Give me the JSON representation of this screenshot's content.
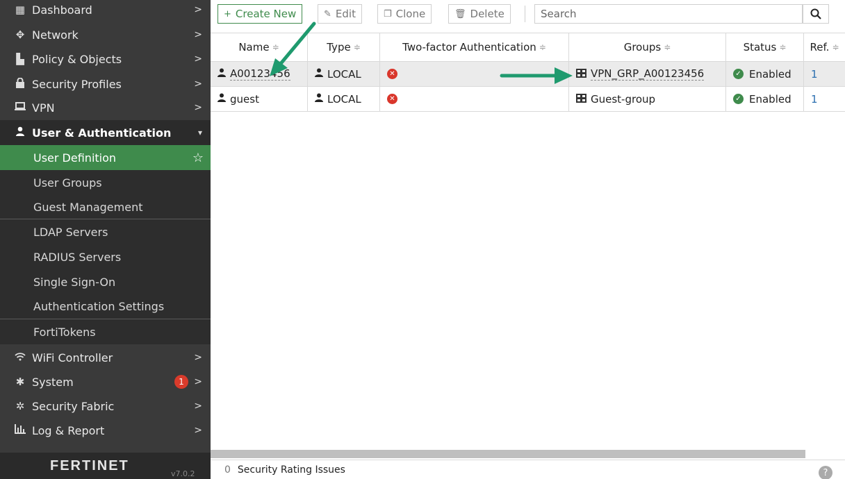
{
  "sidebar": {
    "items": [
      {
        "label": "Dashboard",
        "icon": "dashboard-icon",
        "glyph": "▦"
      },
      {
        "label": "Network",
        "icon": "network-icon",
        "glyph": "✥"
      },
      {
        "label": "Policy & Objects",
        "icon": "policy-icon",
        "glyph": "▙"
      },
      {
        "label": "Security Profiles",
        "icon": "lock-icon",
        "glyph": "🔒"
      },
      {
        "label": "VPN",
        "icon": "laptop-icon",
        "glyph": "▭"
      },
      {
        "label": "User & Authentication",
        "icon": "user-icon",
        "glyph": "👤"
      }
    ],
    "sub_items": [
      {
        "label": "User Definition"
      },
      {
        "label": "User Groups"
      },
      {
        "label": "Guest Management"
      },
      {
        "label": "LDAP Servers"
      },
      {
        "label": "RADIUS Servers"
      },
      {
        "label": "Single Sign-On"
      },
      {
        "label": "Authentication Settings"
      },
      {
        "label": "FortiTokens"
      }
    ],
    "bottom_items": [
      {
        "label": "WiFi Controller",
        "icon": "wifi-icon",
        "glyph": "ᯤ"
      },
      {
        "label": "System",
        "icon": "gear-icon",
        "glyph": "✱",
        "badge": "1"
      },
      {
        "label": "Security Fabric",
        "icon": "fabric-icon",
        "glyph": "✲"
      },
      {
        "label": "Log & Report",
        "icon": "chart-icon",
        "glyph": "▥"
      }
    ],
    "logo": "FERTINET",
    "version": "v7.0.2"
  },
  "toolbar": {
    "create_label": "Create New",
    "edit_label": "Edit",
    "clone_label": "Clone",
    "delete_label": "Delete",
    "search_placeholder": "Search"
  },
  "table": {
    "columns": [
      "Name",
      "Type",
      "Two-factor Authentication",
      "Groups",
      "Status",
      "Ref."
    ],
    "sort_glyph": "≑",
    "rows": [
      {
        "name": "A00123456",
        "type": "LOCAL",
        "two_factor": "disabled",
        "group": "VPN_GRP_A00123456",
        "status": "Enabled",
        "ref": "1"
      },
      {
        "name": "guest",
        "type": "LOCAL",
        "two_factor": "disabled",
        "group": "Guest-group",
        "status": "Enabled",
        "ref": "1"
      }
    ]
  },
  "footer": {
    "count": "0",
    "label": "Security Rating Issues"
  },
  "colors": {
    "accent_green": "#3f8b4c",
    "sidebar_bg": "#3a3a3a",
    "error_red": "#d9362b",
    "annotation_arrow": "#1f9a6e"
  }
}
